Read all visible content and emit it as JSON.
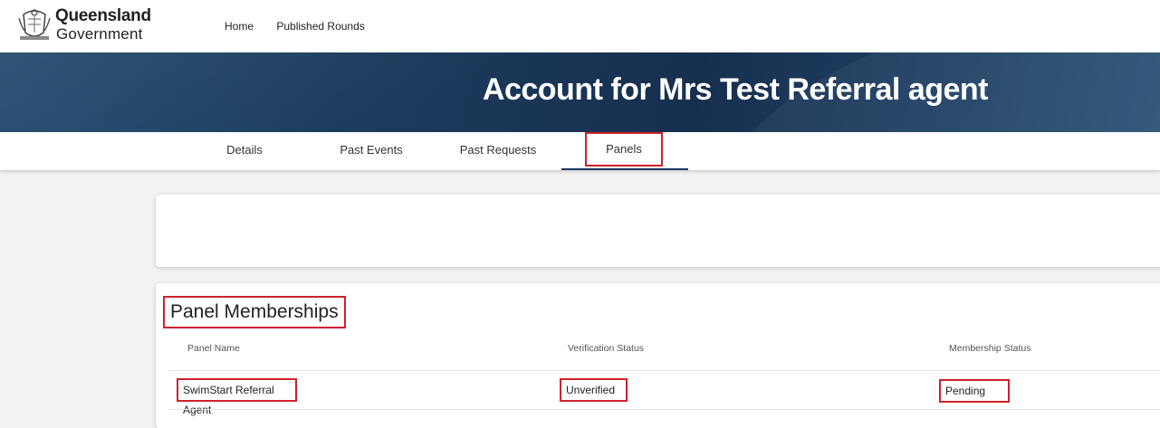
{
  "header": {
    "logo_line1": "Queensland",
    "logo_line2": "Government",
    "nav": [
      "Home",
      "Published Rounds"
    ]
  },
  "banner": {
    "title": "Account for Mrs Test Referral agent"
  },
  "tabs": [
    {
      "label": "Details"
    },
    {
      "label": "Past Events"
    },
    {
      "label": "Past Requests"
    },
    {
      "label": "Panels"
    }
  ],
  "active_tab": "Panels",
  "panel_memberships": {
    "title": "Panel Memberships",
    "columns": [
      "Panel Name",
      "Verification Status",
      "Membership Status"
    ],
    "rows": [
      {
        "panel_name": "SwimStart Referral Agent",
        "verification_status": "Unverified",
        "membership_status": "Pending"
      }
    ]
  },
  "colors": {
    "banner": "#1b3a5c",
    "highlight": "#d0212d"
  }
}
